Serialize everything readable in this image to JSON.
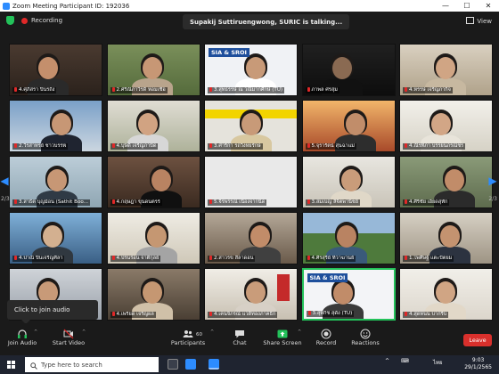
{
  "window": {
    "title": "Zoom Meeting Participant ID: 192036",
    "min": "—",
    "max": "☐",
    "close": "✕"
  },
  "topbar": {
    "recording_label": "Recording",
    "talking": "Supakij Suttiruengwong, SURIC is talking...",
    "view_label": "View"
  },
  "pager": {
    "left": "2/3",
    "right": "2/3",
    "left_arrow": "◀",
    "right_arrow": "▶"
  },
  "participants": [
    {
      "label": "4.ศุภิสรา ปิ่นรถึง",
      "scene": "bookshelf"
    },
    {
      "label": "2.ศรีณิภาวิรดี หอมเชื้อ",
      "scene": "trees"
    },
    {
      "label": "3.สุทธรรษ์ ณ วณีมากศึกษ์ (TU)",
      "scene": "sia"
    },
    {
      "label": "ภาพล ศรสุม",
      "scene": "dark"
    },
    {
      "label": "4.หรรษ์ เจริญภากิจ",
      "scene": "room"
    },
    {
      "label": "2.วีรสาทรย์ ชาวบรรพ์",
      "scene": "building"
    },
    {
      "label": "4.บุษิดี เจริญภาบิด",
      "scene": "plant"
    },
    {
      "label": "3.ศาริกา รถวิงหยรักษ์",
      "scene": "yellow"
    },
    {
      "label": "5.จุรารัตน์ สุนฉาแม่",
      "scene": "bridge"
    },
    {
      "label": "4.ณิรทิภา บรรยนภรณ์ชร",
      "scene": "white"
    },
    {
      "label": "3.สาธิต บุญม้อน (Sathit Boo...",
      "scene": "window"
    },
    {
      "label": "4.กฤษฎา ขุนดนตรร์",
      "scene": "face"
    },
    {
      "label": "5.จิรพรรณ์ เนื่องจากนิด",
      "scene": "blank"
    },
    {
      "label": "3.สมเบญ ลีจิตพานิชย์",
      "scene": "light"
    },
    {
      "label": "4.ศิริชัย เอียดสุทัก",
      "scene": "headset"
    },
    {
      "label": "4.ปาณิ ปิ่นเจริญศิลา",
      "scene": "cartoon"
    },
    {
      "label": "4.ปรนร่อน จาตีกุลย์",
      "scene": "curtain"
    },
    {
      "label": "2.สาวรข สีลาดอน",
      "scene": "couch"
    },
    {
      "label": "4.ศิรสุรีย์ ทิวาฆานย์",
      "scene": "field"
    },
    {
      "label": "1.ไพศิษฐ์ แตะปัตยม",
      "scene": "office"
    },
    {
      "label": "4.ปารฉาสท์",
      "scene": "ceiling"
    },
    {
      "label": "4.เพรียด เจริญผล",
      "scene": "indoor"
    },
    {
      "label": "4.เคนจิภรณ์ แวดิทองภาคธิก",
      "scene": "red"
    },
    {
      "label": "3.สุพิกิช สุดัง (TU)",
      "scene": "sia2"
    },
    {
      "label": "4.สุดหนน บากรีบ",
      "scene": "wall"
    }
  ],
  "sia_text": "SIA & SROI",
  "tooltip": "Click to join audio",
  "toolbar": {
    "join_audio": "Join Audio",
    "start_video": "Start Video",
    "participants": "Participants",
    "participants_count": "60",
    "chat": "Chat",
    "share_screen": "Share Screen",
    "record": "Record",
    "reactions": "Reactions",
    "leave": "Leave"
  },
  "taskbar": {
    "search_placeholder": "Type here to search",
    "lang": "ไทย",
    "time": "9:03",
    "date": "29/1/2565"
  },
  "colors": {
    "accent": "#2d8cff",
    "leave": "#d9302c",
    "active_speaker": "#23c25a",
    "shield": "#23c25a"
  }
}
